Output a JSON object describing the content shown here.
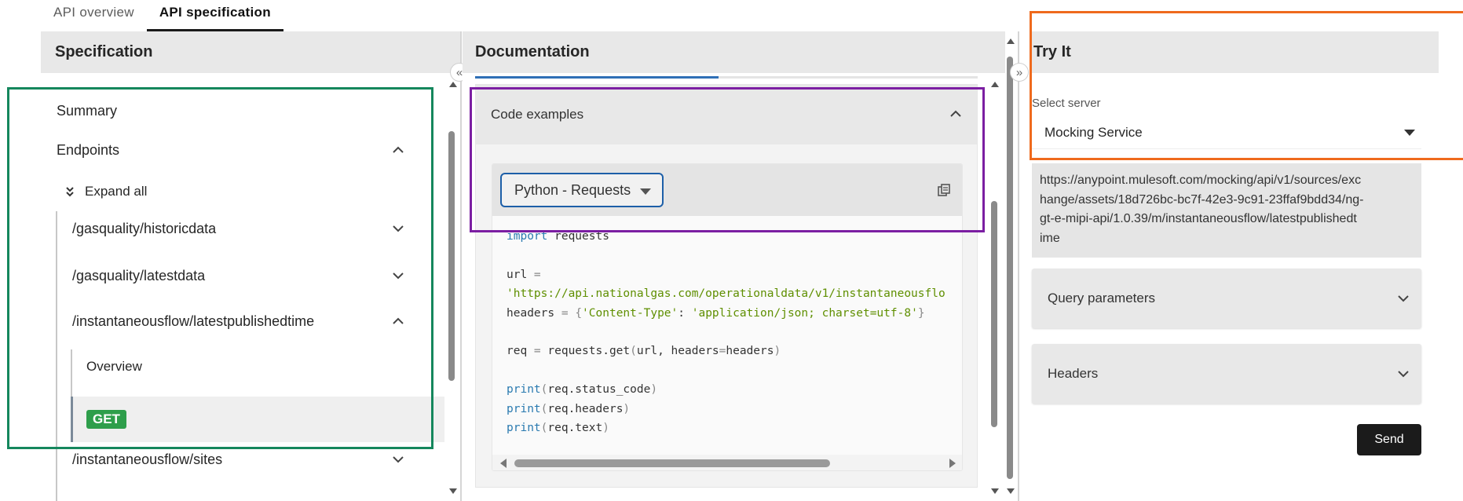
{
  "tabs": [
    {
      "label": "API overview",
      "active": false
    },
    {
      "label": "API specification",
      "active": true
    }
  ],
  "specification": {
    "title": "Specification",
    "summary": "Summary",
    "endpoints": "Endpoints",
    "expand_all": "Expand all",
    "items": [
      {
        "label": "/gasquality/historicdata",
        "expanded": false
      },
      {
        "label": "/gasquality/latestdata",
        "expanded": false
      },
      {
        "label": "/instantaneousflow/latestpublishedtime",
        "expanded": true
      },
      {
        "label": "/instantaneousflow/sites",
        "expanded": false
      }
    ],
    "sub_overview": "Overview",
    "sub_method": "GET"
  },
  "documentation": {
    "title": "Documentation",
    "code_examples": "Code examples",
    "language": "Python - Requests",
    "code_lines": [
      "import requests",
      "",
      "url = ",
      "'https://api.nationalgas.com/operationaldata/v1/instantaneousflo",
      "headers = {'Content-Type': 'application/json; charset=utf-8'}",
      "",
      "req = requests.get(url, headers=headers)",
      "",
      "print(req.status_code)",
      "print(req.headers)",
      "print(req.text)"
    ]
  },
  "try_it": {
    "title": "Try It",
    "server_label": "Select server",
    "server_value": "Mocking Service",
    "url": "https://anypoint.mulesoft.com/mocking/api/v1/sources/exchange/assets/18d726bc-bc7f-42e3-9c91-23ffaf9bdd34/ng-gt-e-mipi-api/1.0.39/m/instantaneousflow/latestpublishedtime",
    "url_lines": [
      "https://anypoint.mulesoft.com/mocking/api/v1/sources/exc",
      "hange/assets/18d726bc-bc7f-42e3-9c91-23ffaf9bdd34/ng-",
      "gt-e-mipi-api/1.0.39/m/instantaneousflow/latestpublishedt",
      "ime"
    ],
    "query_parameters": "Query parameters",
    "headers": "Headers",
    "send": "Send"
  },
  "colors": {
    "active_tab_underline": "#1a1a1a",
    "get_badge": "#2e9e4b",
    "lang_select_border": "#1d5fa8",
    "send_button": "#1b1b1b",
    "highlight_green": "#15875d",
    "highlight_purple": "#7b1ea2",
    "highlight_orange": "#ef6a1d"
  }
}
